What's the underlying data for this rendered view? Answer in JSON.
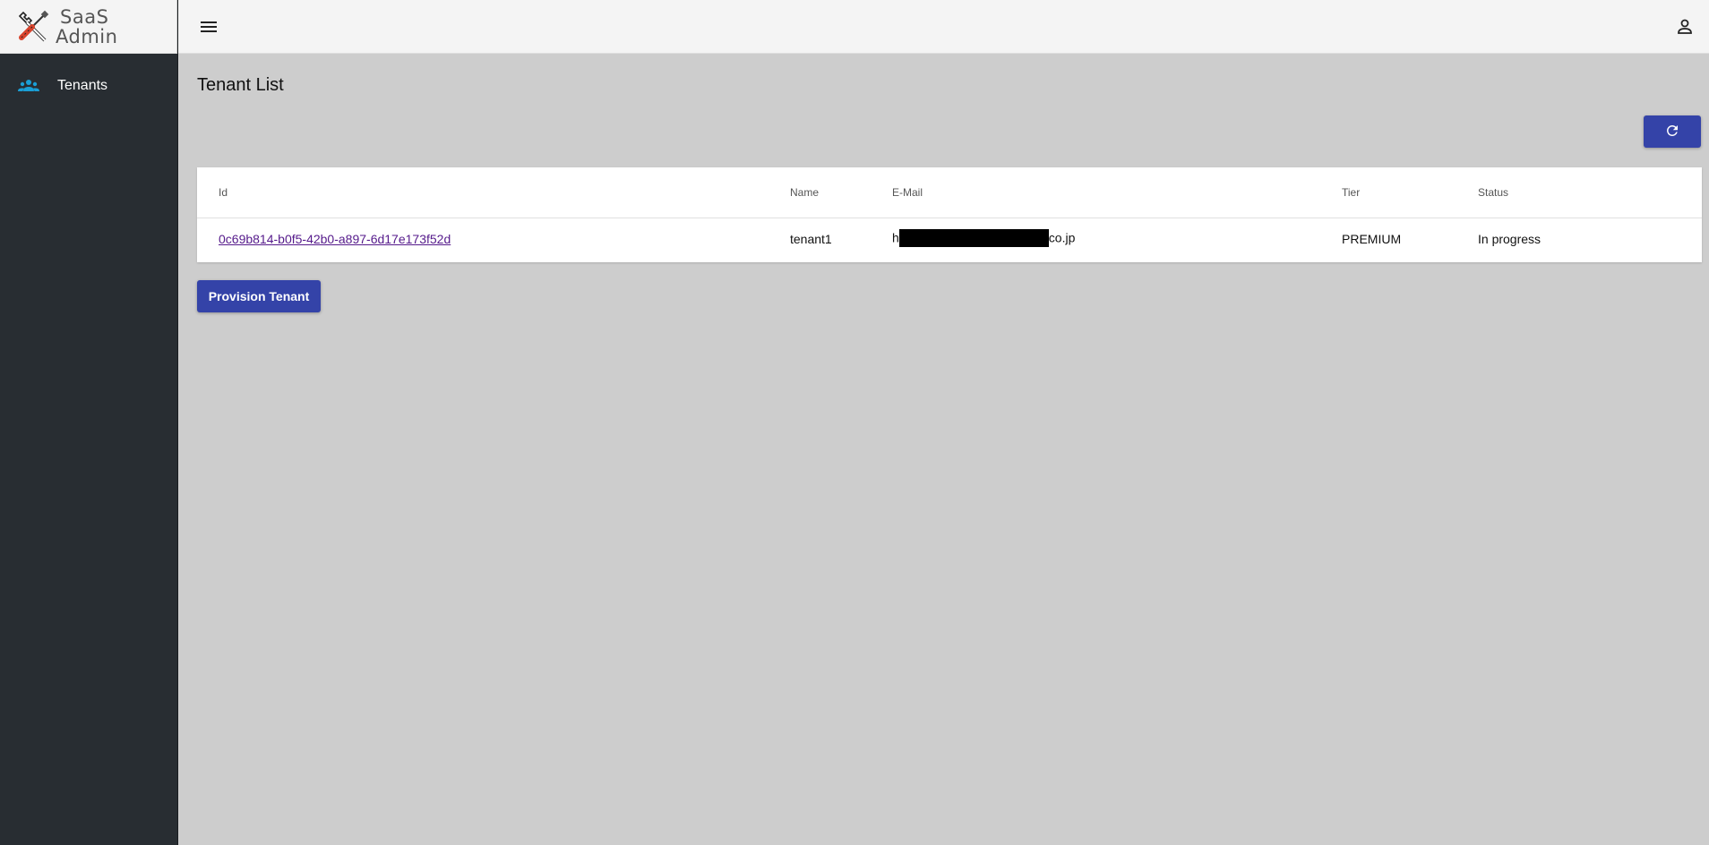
{
  "brand": {
    "line1": "SaaS",
    "line2": "Admin",
    "logo_icon": "wrench-screwdriver-icon"
  },
  "sidebar": {
    "items": [
      {
        "label": "Tenants",
        "icon": "people-icon",
        "icon_color": "#1a9fd6"
      }
    ]
  },
  "header": {
    "menu_icon": "hamburger-menu-icon",
    "user_icon": "user-account-icon"
  },
  "page": {
    "title": "Tenant List",
    "refresh_icon": "refresh-icon"
  },
  "table": {
    "columns": [
      "Id",
      "Name",
      "E-Mail",
      "Tier",
      "Status"
    ],
    "rows": [
      {
        "id": "0c69b814-b0f5-42b0-a897-6d17e173f52d",
        "name": "tenant1",
        "email_prefix": "h",
        "email_suffix": "co.jp",
        "tier": "PREMIUM",
        "status": "In progress"
      }
    ]
  },
  "actions": {
    "provision_label": "Provision Tenant"
  },
  "colors": {
    "accent": "#3443a8",
    "sidebar_bg": "#282d32",
    "content_bg": "#cdcdcd",
    "topbar_bg": "#f4f4f4"
  }
}
